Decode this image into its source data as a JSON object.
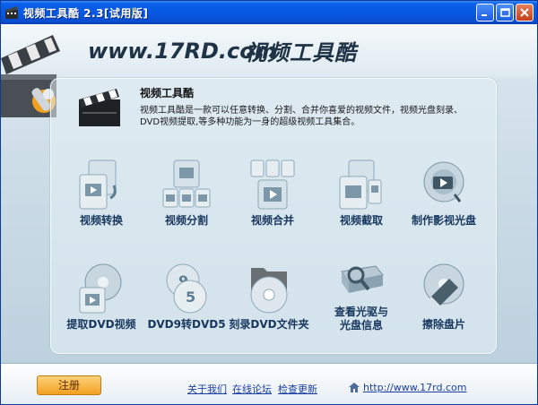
{
  "window": {
    "title": "视频工具酷 2.3[试用版]"
  },
  "header": {
    "logo_text": "www.17RD.com",
    "logo_cn": "视频工具酷"
  },
  "intro": {
    "title": "视频工具酷",
    "desc_line1": "视频工具酷是一款可以任意转换、分割、合并你喜爱的视频文件，视频光盘刻录、",
    "desc_line2": "DVD视频提取,等多种功能为一身的超级视频工具集合。"
  },
  "tools": [
    {
      "label": "视频转换",
      "icon": "video-convert-icon"
    },
    {
      "label": "视频分割",
      "icon": "video-split-icon"
    },
    {
      "label": "视频合并",
      "icon": "video-merge-icon"
    },
    {
      "label": "视频截取",
      "icon": "video-clip-icon"
    },
    {
      "label": "制作影视光盘",
      "icon": "make-video-disc-icon"
    },
    {
      "label": "提取DVD视频",
      "icon": "extract-dvd-icon"
    },
    {
      "label": "DVD9转DVD5",
      "icon": "dvd9-to-dvd5-icon"
    },
    {
      "label": "刻录DVD文件夹",
      "icon": "burn-dvd-folder-icon"
    },
    {
      "label_line1": "查看光驱与",
      "label_line2": "光盘信息",
      "icon": "drive-info-icon"
    },
    {
      "label": "擦除盘片",
      "icon": "erase-disc-icon"
    }
  ],
  "footer": {
    "register": "注册",
    "about": "关于我们",
    "forum": "在线论坛",
    "update": "检查更新",
    "website": "http://www.17rd.com"
  },
  "colors": {
    "titlebar": "#0758e2",
    "label": "#17375e",
    "link": "#1a3fa0",
    "register_btn": "#f2a022"
  }
}
